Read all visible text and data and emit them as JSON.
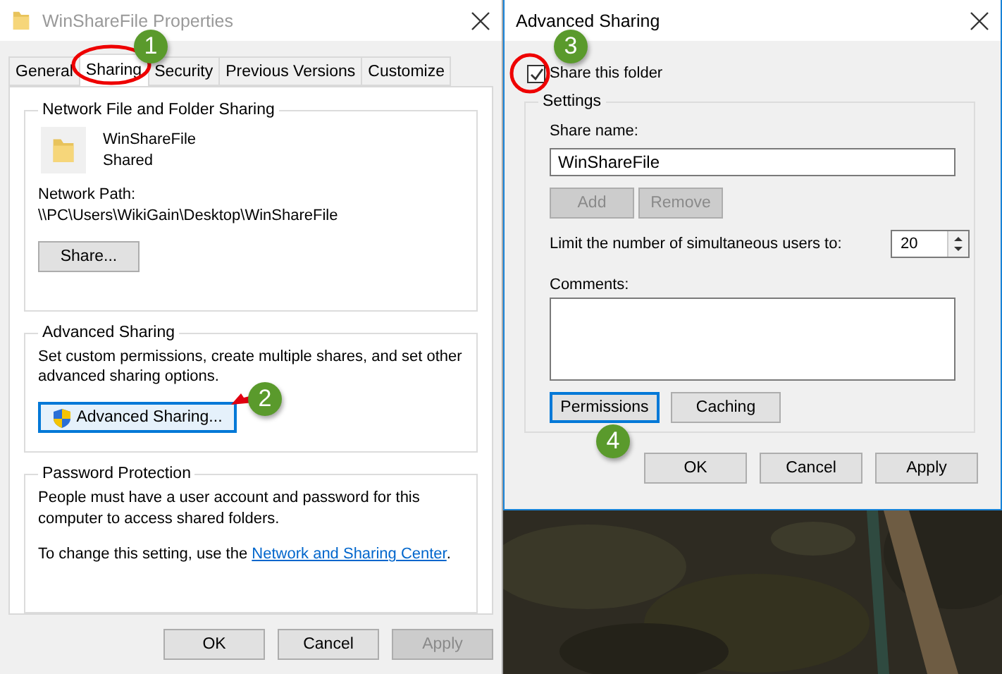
{
  "properties_window": {
    "title": "WinShareFile Properties",
    "tabs": [
      {
        "label": "General",
        "selected": false
      },
      {
        "label": "Sharing",
        "selected": true
      },
      {
        "label": "Security",
        "selected": false
      },
      {
        "label": "Previous Versions",
        "selected": false
      },
      {
        "label": "Customize",
        "selected": false
      }
    ],
    "network_sharing": {
      "legend": "Network File and Folder Sharing",
      "folder_name": "WinShareFile",
      "status": "Shared",
      "path_label": "Network Path:",
      "path": "\\\\PC\\Users\\WikiGain\\Desktop\\WinShareFile",
      "button": "Share..."
    },
    "advanced_sharing": {
      "legend": "Advanced Sharing",
      "description": "Set custom permissions, create multiple shares, and set other advanced sharing options.",
      "button": "Advanced Sharing..."
    },
    "password_protection": {
      "legend": "Password Protection",
      "description": "People must have a user account and password for this computer to access shared folders.",
      "change_text": "To change this setting, use the",
      "link": "Network and Sharing Center",
      "after_link": "."
    },
    "buttons": [
      {
        "label": "OK",
        "disabled": false
      },
      {
        "label": "Cancel",
        "disabled": false
      },
      {
        "label": "Apply",
        "disabled": true
      }
    ]
  },
  "advanced_window": {
    "title": "Advanced Sharing",
    "share_checkbox": {
      "label": "Share this folder",
      "checked": true
    },
    "settings_legend": "Settings",
    "share_name_label": "Share name:",
    "share_name": "WinShareFile",
    "name_buttons": [
      {
        "label": "Add",
        "disabled": true
      },
      {
        "label": "Remove",
        "disabled": true
      }
    ],
    "limit_label": "Limit the number of simultaneous users to:",
    "limit": "20",
    "comments_label": "Comments:",
    "option_buttons": [
      {
        "label": "Permissions",
        "focused": true
      },
      {
        "label": "Caching",
        "focused": false
      }
    ],
    "buttons": [
      {
        "label": "OK",
        "disabled": false
      },
      {
        "label": "Cancel",
        "disabled": false
      },
      {
        "label": "Apply",
        "disabled": false
      }
    ]
  },
  "step_badges": [
    {
      "label": "1"
    },
    {
      "label": "2"
    },
    {
      "label": "3"
    },
    {
      "label": "4"
    }
  ]
}
